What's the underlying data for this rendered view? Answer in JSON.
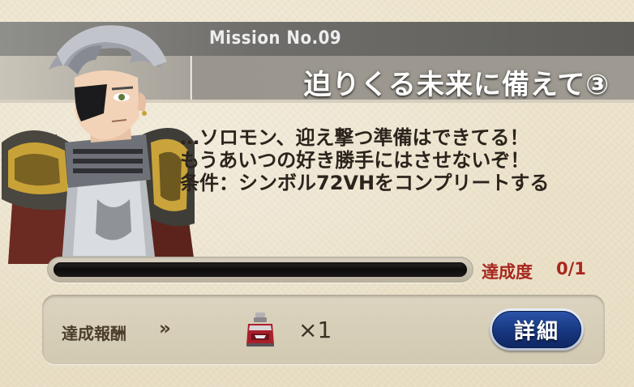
{
  "mission": {
    "number_label": "Mission No.09",
    "title": "迫りくる未来に備えて③"
  },
  "character": {
    "icon": "knight-character-portrait"
  },
  "dialogue": {
    "lines": [
      "…ソロモン、迎え撃つ準備はできてる！",
      "もうあいつの好き勝手にはさせないぞ！",
      "条件：シンボル72VHをコンプリートする"
    ]
  },
  "progress": {
    "label": "達成度",
    "count": "0/1",
    "fraction": 0
  },
  "reward": {
    "label": "達成報酬",
    "arrows": "»",
    "item_icon": "treasure-bottle-icon",
    "quantity": "×1"
  },
  "detail_button": {
    "label": "詳細"
  },
  "colors": {
    "progress_text": "#a8271d",
    "button_blue": "#17367f",
    "header_dark": "#6f6e6b"
  }
}
